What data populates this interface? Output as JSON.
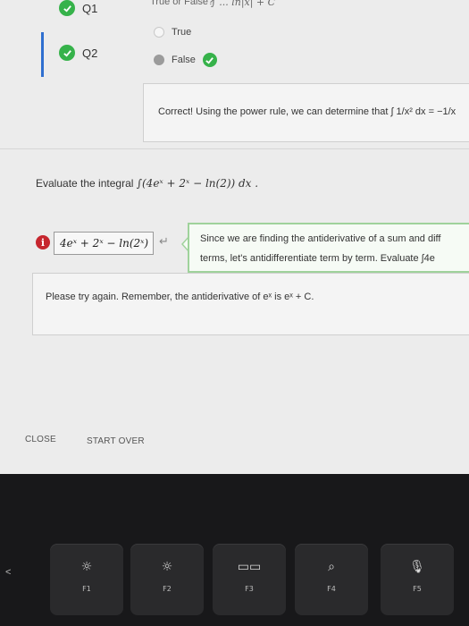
{
  "questions": {
    "q1_label": "Q1",
    "q2_label": "Q2",
    "top_note": "True or False?",
    "top_math": "∫ ... ln|x| + C"
  },
  "q2": {
    "option_true": "True",
    "option_false": "False",
    "feedback": "Correct! Using the power rule, we can determine that ∫ 1/x² dx = −1/x"
  },
  "problem": {
    "prompt": "Evaluate the integral",
    "integral": "∫(4eˣ + 2ˣ − ln(2)) dx ."
  },
  "answer": {
    "value": "4eˣ + 2ˣ − ln(2ˣ)",
    "hint_line1": "Since we are finding the antiderivative of a sum and diff",
    "hint_line2": "terms, let's antidifferentiate term by term. Evaluate ∫4e",
    "feedback": "Please try again. Remember, the antiderivative of eˣ is eˣ + C."
  },
  "buttons": {
    "close": "CLOSE",
    "start_over": "START OVER"
  },
  "keyboard": {
    "keys": [
      {
        "label": "F1",
        "icon": "brightness-low-icon",
        "glyph": "☼"
      },
      {
        "label": "F2",
        "icon": "brightness-high-icon",
        "glyph": "☼"
      },
      {
        "label": "F3",
        "icon": "mission-control-icon",
        "glyph": "▭▭"
      },
      {
        "label": "F4",
        "icon": "search-icon",
        "glyph": "⌕"
      },
      {
        "label": "F5",
        "icon": "microphone-icon",
        "glyph": "🎙"
      }
    ],
    "esc_glyph": "<"
  },
  "colors": {
    "check_green": "#36b24a",
    "selected_bar": "#2f6fd0",
    "error_red": "#c6262e",
    "hint_border": "#9fd29b"
  }
}
